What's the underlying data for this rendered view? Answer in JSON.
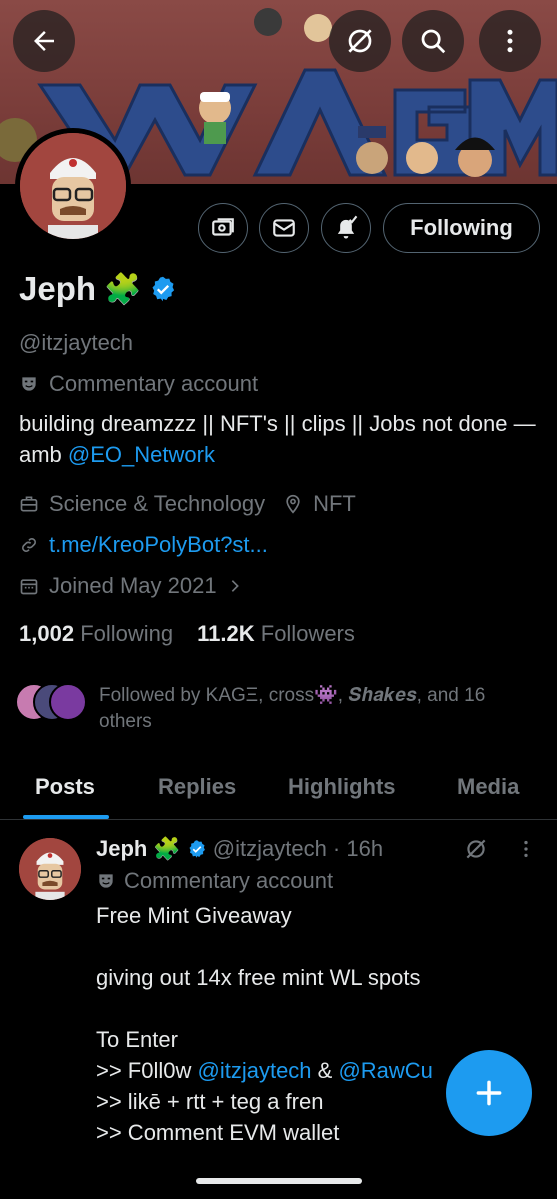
{
  "banner": {
    "text": "WAGMI"
  },
  "profile": {
    "name": "Jeph",
    "name_emoji": "🧩",
    "handle": "@itzjaytech",
    "label": "Commentary account",
    "bio_text": "building dreamzzz || NFT's || clips || Jobs not done — amb",
    "bio_mention": "@EO_Network",
    "category": "Science & Technology",
    "location": "NFT",
    "website": "t.me/KreoPolyBot?st...",
    "joined": "Joined May 2021",
    "following_count": "1,002",
    "following_label": "Following",
    "followers_count": "11.2K",
    "followers_label": "Followers",
    "followed_by": "Followed by KAGΞ, cross👾, 𝑺𝒉𝒂𝒌𝒆𝒔, and 16 others"
  },
  "actions": {
    "following_button": "Following"
  },
  "tabs": [
    "Posts",
    "Replies",
    "Highlights",
    "Media"
  ],
  "post": {
    "name": "Jeph",
    "emoji": "🧩",
    "handle_time": "@itzjaytech · 16h",
    "label": "Commentary account",
    "line1": "Free Mint Giveaway",
    "line2": "giving out 14x free mint WL spots",
    "line3": "To Enter",
    "line4_prefix": ">> F0ll0w ",
    "line4_m1": "@itzjaytech",
    "line4_mid": " & ",
    "line4_m2": "@RawCu",
    "line5": ">> likē + rtt + teg a fren",
    "line6": ">> Comment EVM wallet"
  },
  "colors": {
    "accent": "#1d9bf0",
    "muted": "#71767b",
    "text": "#e7e9ea"
  }
}
